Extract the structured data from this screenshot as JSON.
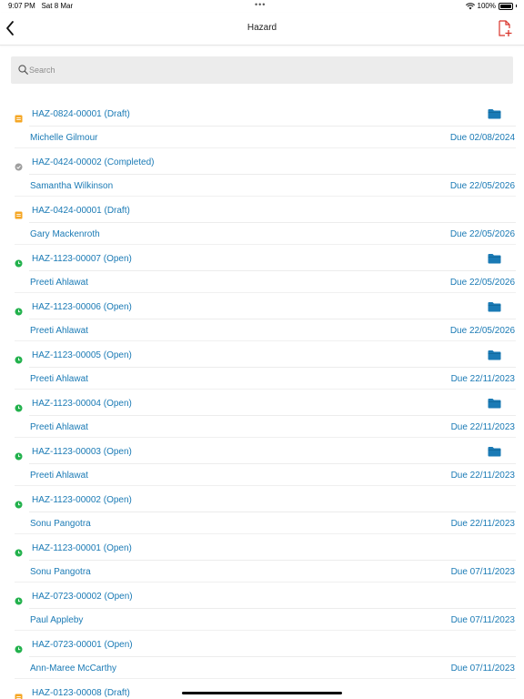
{
  "status_bar": {
    "time": "9:07 PM",
    "date": "Sat 8 Mar",
    "battery": "100%",
    "dots": "•••"
  },
  "header": {
    "title": "Hazard"
  },
  "search": {
    "placeholder": "Search"
  },
  "colors": {
    "link": "#1a7ab5",
    "draft": "#f5a623",
    "completed": "#9e9e9e",
    "open": "#22b14c",
    "folder": "#1a7ab5"
  },
  "items": [
    {
      "ref": "HAZ-0824-00001  (Draft)",
      "status": "draft",
      "assignee": "Michelle Gilmour",
      "due": "Due 02/08/2024",
      "has_folder": true
    },
    {
      "ref": "HAZ-0424-00002  (Completed)",
      "status": "completed",
      "assignee": "Samantha Wilkinson",
      "due": "Due 22/05/2026",
      "has_folder": false
    },
    {
      "ref": "HAZ-0424-00001  (Draft)",
      "status": "draft",
      "assignee": "Gary Mackenroth",
      "due": "Due 22/05/2026",
      "has_folder": false
    },
    {
      "ref": "HAZ-1123-00007  (Open)",
      "status": "open",
      "assignee": "Preeti Ahlawat",
      "due": "Due 22/05/2026",
      "has_folder": true
    },
    {
      "ref": "HAZ-1123-00006  (Open)",
      "status": "open",
      "assignee": "Preeti Ahlawat",
      "due": "Due 22/05/2026",
      "has_folder": true
    },
    {
      "ref": "HAZ-1123-00005  (Open)",
      "status": "open",
      "assignee": "Preeti Ahlawat",
      "due": "Due 22/11/2023",
      "has_folder": true
    },
    {
      "ref": "HAZ-1123-00004  (Open)",
      "status": "open",
      "assignee": "Preeti Ahlawat",
      "due": "Due 22/11/2023",
      "has_folder": true
    },
    {
      "ref": "HAZ-1123-00003  (Open)",
      "status": "open",
      "assignee": "Preeti Ahlawat",
      "due": "Due 22/11/2023",
      "has_folder": true
    },
    {
      "ref": "HAZ-1123-00002  (Open)",
      "status": "open",
      "assignee": "Sonu Pangotra",
      "due": "Due 22/11/2023",
      "has_folder": false
    },
    {
      "ref": "HAZ-1123-00001  (Open)",
      "status": "open",
      "assignee": "Sonu Pangotra",
      "due": "Due 07/11/2023",
      "has_folder": false
    },
    {
      "ref": "HAZ-0723-00002  (Open)",
      "status": "open",
      "assignee": "Paul Appleby",
      "due": "Due 07/11/2023",
      "has_folder": false
    },
    {
      "ref": "HAZ-0723-00001  (Open)",
      "status": "open",
      "assignee": "Ann-Maree McCarthy",
      "due": "Due 07/11/2023",
      "has_folder": false
    },
    {
      "ref": "HAZ-0123-00008  (Draft)",
      "status": "draft",
      "assignee": "",
      "due": "",
      "has_folder": false
    }
  ]
}
